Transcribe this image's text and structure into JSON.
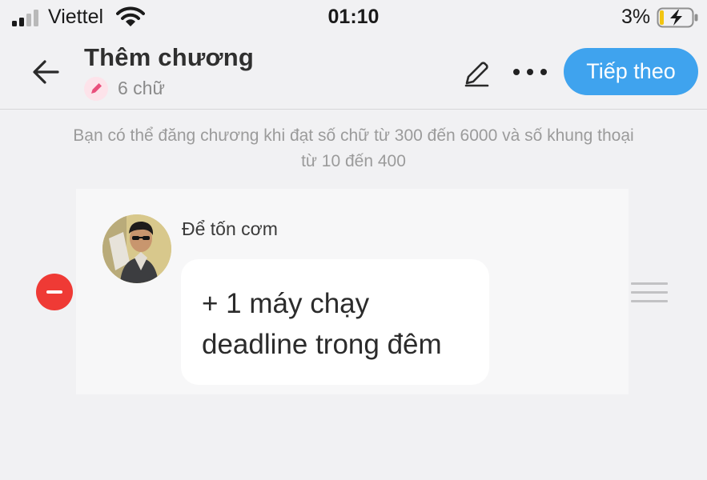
{
  "status_bar": {
    "carrier": "Viettel",
    "time": "01:10",
    "battery_percent": "3%"
  },
  "nav": {
    "title": "Thêm chương",
    "word_count": "6 chữ",
    "next_label": "Tiếp theo",
    "icons": {
      "back": "arrow-left-icon",
      "edit": "pencil-icon",
      "more": "more-horizontal-icon",
      "badge": "pencil-badge-icon"
    }
  },
  "info": {
    "line1": "Bạn có thể đăng chương khi đạt số chữ từ 300 đến 6000 và số khung thoại",
    "line2": "từ 10 đến 400"
  },
  "dialogue": {
    "speaker": "Để tốn cơm",
    "message_line1": "+ 1 máy chạy",
    "message_line2": "deadline trong đêm"
  },
  "colors": {
    "accent": "#3fa3ee",
    "remove": "#ef3a35",
    "pencil": "#e94f7c",
    "background": "#f1f1f3"
  }
}
